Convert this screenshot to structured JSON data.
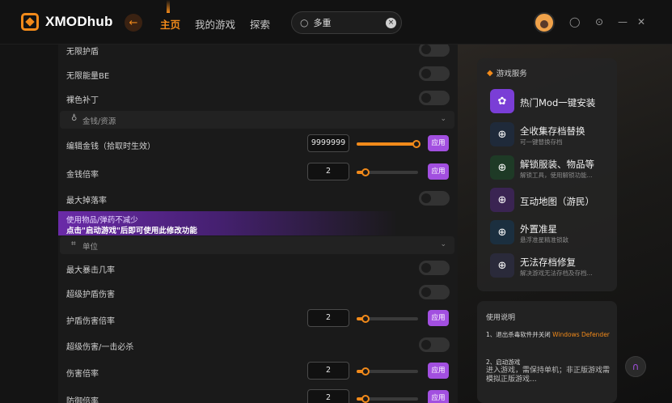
{
  "app": {
    "name": "XMODhub"
  },
  "nav": {
    "back_icon": "back-arrow-icon",
    "items": [
      "主页",
      "我的游戏",
      "探索"
    ],
    "active": "主页"
  },
  "search": {
    "value": "多重",
    "icon": "search-icon"
  },
  "colors": {
    "accent": "#f28a1a",
    "apply": "#a24fe0",
    "panel": "#1a1a1a"
  },
  "settings": {
    "top_rows": [
      "无限护盾",
      "无限能量BE",
      "裸色补丁"
    ],
    "section_money": "金钱/资源",
    "edit_money": {
      "label": "编辑金钱（拾取时生效）",
      "value": "9999999",
      "apply": "应用",
      "level": 0.97
    },
    "money_rate": {
      "label": "金钱倍率",
      "value": "2",
      "apply": "应用",
      "level": 0.15
    },
    "max_drop": "最大掉落率",
    "promo_line1": "使用物品/弹药不减少",
    "promo_line2": "点击\"启动游戏\"后即可使用此修改功能",
    "section_unit": "单位",
    "max_crit": "最大暴击几率",
    "super_shield": "超级护盾伤害",
    "shield_dmg": {
      "label": "护盾伤害倍率",
      "value": "2",
      "apply": "应用",
      "level": 0.15
    },
    "one_hit": "超级伤害/一击必杀",
    "dmg_rate": {
      "label": "伤害倍率",
      "value": "2",
      "apply": "应用",
      "level": 0.15
    },
    "def_rate": {
      "label": "防御倍率",
      "value": "2",
      "apply": "应用",
      "level": 0.15
    }
  },
  "services": {
    "title": "游戏服务",
    "items": [
      {
        "name": "热门Mod一键安装",
        "desc": "",
        "icon": "mod-icon"
      },
      {
        "name": "全收集存档替换",
        "desc": "可一键替换存档",
        "icon": "download-icon"
      },
      {
        "name": "解锁服装、物品等",
        "desc": "解锁工具，使用解锁功能...",
        "icon": "download-icon"
      },
      {
        "name": "互动地图（游民）",
        "desc": "",
        "icon": "map-icon"
      },
      {
        "name": "外置准星",
        "desc": "悬浮准星精准锁敌",
        "icon": "download-icon"
      },
      {
        "name": "无法存档修复",
        "desc": "解决游戏无法存档及存档...",
        "icon": "download-icon"
      }
    ]
  },
  "help": {
    "title": "使用说明",
    "step1_prefix": "1、退出杀毒软件并关闭",
    "step1_hl": "Windows Defender",
    "step2_title": "2、启动游戏",
    "step2_body": "进入游戏，需保持单机；非正版游戏需模拟正版游戏..."
  }
}
